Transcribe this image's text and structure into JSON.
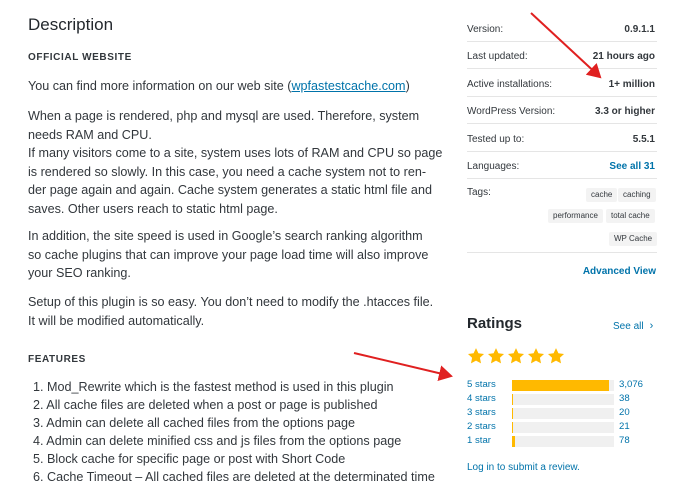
{
  "description": {
    "title": "Description",
    "official_website_heading": "OFFICIAL WEBSITE",
    "website_intro": "You can find more information on our web site (",
    "website_link": "wpfastestcache.com",
    "website_outro": ")",
    "para1_lines": [
      "When a page is rendered, php and mysql are used. Therefore, system",
      "needs RAM and CPU.",
      "If many visitors come to a site, system uses lots of RAM and CPU so page",
      "is rendered so slowly. In this case, you need a cache system not to ren-",
      "der page again and again. Cache system generates a static html file and",
      "saves. Other users reach to static html page."
    ],
    "para2_lines": [
      "In addition, the site speed is used in Google’s search ranking algorithm",
      "so cache plugins that can improve your page load time will also improve",
      "your SEO ranking."
    ],
    "para3_lines": [
      "Setup of this plugin is so easy. You don’t need to modify the .htacces file.",
      "It will be modified automatically."
    ],
    "features_heading": "FEATURES",
    "features": [
      "1. Mod_Rewrite which is the fastest method is used in this plugin",
      "2. All cache files are deleted when a post or page is published",
      "3. Admin can delete all cached files from the options page",
      "4. Admin can delete minified css and js files from the options page",
      "5. Block cache for specific page or post with Short Code",
      "6. Cache Timeout – All cached files are deleted at the determinated time"
    ]
  },
  "meta": {
    "version_label": "Version:",
    "version_value": "0.9.1.1",
    "updated_label": "Last updated:",
    "updated_value": "21 hours ago",
    "installs_label": "Active installations:",
    "installs_value": "1+ million",
    "wp_label": "WordPress Version:",
    "wp_value": "3.3 or higher",
    "tested_label": "Tested up to:",
    "tested_value": "5.5.1",
    "languages_label": "Languages:",
    "languages_value": "See all 31",
    "tags_label": "Tags:",
    "tags": [
      "cache",
      "caching",
      "performance",
      "total cache",
      "WP Cache"
    ],
    "advanced_view": "Advanced View"
  },
  "ratings": {
    "title": "Ratings",
    "see_all": "See all",
    "star_count": 5,
    "star_color": "#ffb900",
    "rows": [
      {
        "label": "5 stars",
        "count": "3,076",
        "fraction": 0.95
      },
      {
        "label": "4 stars",
        "count": "38",
        "fraction": 0.012
      },
      {
        "label": "3 stars",
        "count": "20",
        "fraction": 0.007
      },
      {
        "label": "2 stars",
        "count": "21",
        "fraction": 0.007
      },
      {
        "label": "1 star",
        "count": "78",
        "fraction": 0.025
      }
    ],
    "login_link": "Log in to submit a review."
  },
  "colors": {
    "link": "#0073aa",
    "arrow": "#e02020"
  }
}
